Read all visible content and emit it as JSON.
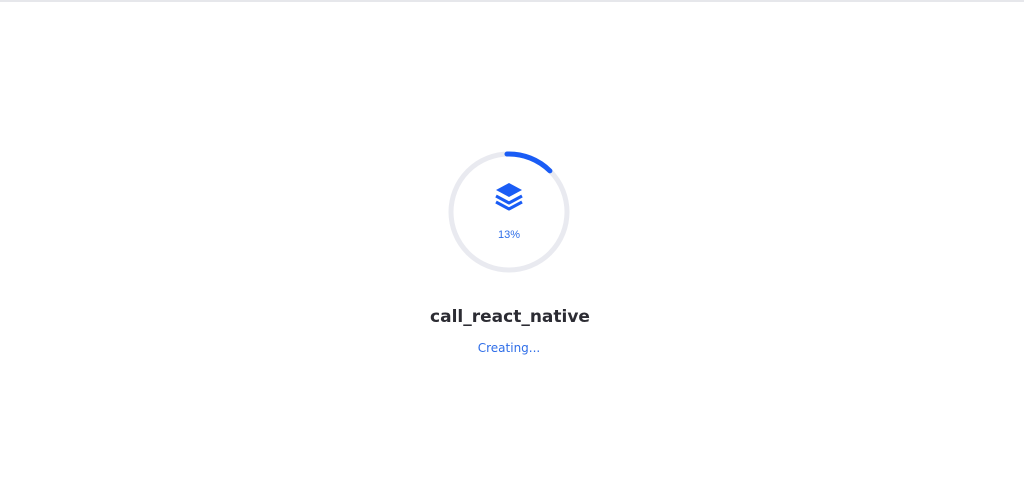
{
  "loader": {
    "progress_percent": 13,
    "progress_label": "13%",
    "icon": "layers-icon",
    "project_name": "call_react_native",
    "status": "Creating..."
  },
  "colors": {
    "accent": "#1a5cf5",
    "track": "#e9eaf0",
    "title": "#2c2c33",
    "status": "#2f6ee8"
  }
}
